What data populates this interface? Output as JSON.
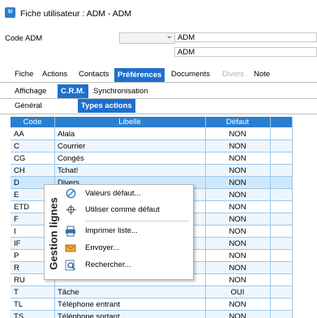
{
  "window": {
    "title": "Fiche utilisateur : ADM - ADM",
    "icon": "app-icon",
    "icon_label": "SI"
  },
  "header": {
    "code_label": "Code",
    "code_value": "ADM",
    "combo_value": "",
    "name_field": "ADM",
    "short_field": "ADM"
  },
  "tabs": [
    {
      "label": "Fiche"
    },
    {
      "label": "Actions"
    },
    {
      "label": "Contacts"
    },
    {
      "label": "Préférences",
      "active": true
    },
    {
      "label": "Documents"
    },
    {
      "label": "Divers",
      "disabled": true
    },
    {
      "label": "Note"
    }
  ],
  "subtabs": [
    {
      "label": "Affichage"
    },
    {
      "label": "C.R.M.",
      "active": true
    },
    {
      "label": "Synchronisation"
    }
  ],
  "subtabs2": [
    {
      "label": "Général"
    },
    {
      "label": "Types actions",
      "active": true
    }
  ],
  "grid": {
    "columns": [
      "Code",
      "Libellé",
      "Défaut"
    ],
    "rows": [
      [
        "AA",
        "Alala",
        "NON"
      ],
      [
        "C",
        "Courrier",
        "NON"
      ],
      [
        "CG",
        "Congés",
        "NON"
      ],
      [
        "CH",
        "Tchat!",
        "NON"
      ],
      [
        "D",
        "Divers",
        "NON"
      ],
      [
        "E",
        "",
        "NON"
      ],
      [
        "ETD",
        "",
        "NON"
      ],
      [
        "F",
        "",
        "NON"
      ],
      [
        "I",
        "",
        "NON"
      ],
      [
        "IF",
        "",
        "NON"
      ],
      [
        "P",
        "",
        "NON"
      ],
      [
        "R",
        "",
        "NON"
      ],
      [
        "RU",
        "",
        "NON"
      ],
      [
        "T",
        "Tâche",
        "OUI"
      ],
      [
        "TL",
        "Téléphone entrant",
        "NON"
      ],
      [
        "TS",
        "Téléphone sortant",
        "NON"
      ]
    ]
  },
  "context_menu": {
    "side_title": "Gestion lignes",
    "items": [
      {
        "label": "Valeurs défaut...",
        "icon": "no-entry-icon"
      },
      {
        "label": "Utiliser comme défaut",
        "icon": "crosshair-icon"
      },
      {
        "label": "Imprimer liste...",
        "icon": "printer-icon"
      },
      {
        "label": "Envoyer...",
        "icon": "mail-icon"
      },
      {
        "label": "Rechercher...",
        "icon": "search-icon"
      }
    ]
  },
  "colors": {
    "accent": "#1e6fcc",
    "header_bg": "#2a7fd1",
    "row_alt": "#eef6fd",
    "grid_line": "#9cc9ef"
  }
}
